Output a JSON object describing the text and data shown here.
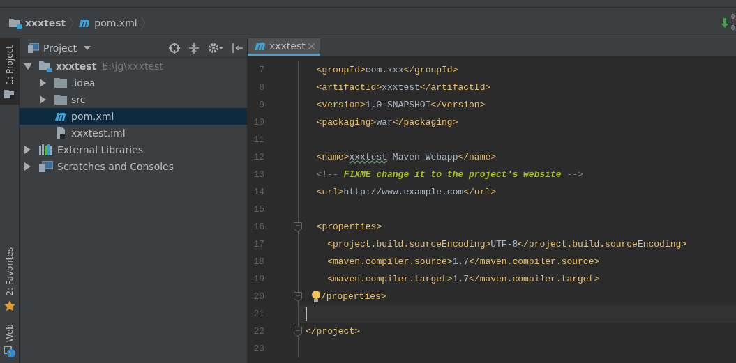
{
  "breadcrumb": [
    {
      "label": "xxxtest",
      "kind": "module"
    },
    {
      "label": "pom.xml",
      "kind": "maven"
    }
  ],
  "vcs_counter": [
    "0",
    "1",
    "0"
  ],
  "side_tabs": [
    {
      "label": "1: Project",
      "selected": true,
      "kind": "project"
    },
    {
      "label": "2: Favorites",
      "selected": false,
      "kind": "favorites"
    },
    {
      "label": "Web",
      "selected": false,
      "kind": "web"
    }
  ],
  "project_panel": {
    "title": "Project",
    "tree": [
      {
        "label": "xxxtest",
        "hint": "E:\\jg\\xxxtest",
        "kind": "module",
        "expanded": true,
        "selected": false,
        "children": [
          {
            "label": ".idea",
            "kind": "folder",
            "expanded": false,
            "selected": false
          },
          {
            "label": "src",
            "kind": "folder",
            "expanded": false,
            "selected": false
          },
          {
            "label": "pom.xml",
            "kind": "maven",
            "selected": true
          },
          {
            "label": "xxxtest.iml",
            "kind": "file",
            "selected": false
          }
        ]
      },
      {
        "label": "External Libraries",
        "kind": "libraries",
        "expanded": false,
        "selected": false
      },
      {
        "label": "Scratches and Consoles",
        "kind": "scratches",
        "expanded": false,
        "selected": false
      }
    ]
  },
  "editor": {
    "tabs": [
      {
        "label": "xxxtest",
        "selected": true
      }
    ],
    "lines": [
      {
        "number": "7",
        "tokens": [
          {
            "kind": "tag",
            "text": "  <groupId>"
          },
          {
            "kind": "text",
            "text": "com.xxx"
          },
          {
            "kind": "tag",
            "text": "</groupId>"
          }
        ]
      },
      {
        "number": "8",
        "tokens": [
          {
            "kind": "tag",
            "text": "  <artifactId>"
          },
          {
            "kind": "text",
            "text": "xxxtest"
          },
          {
            "kind": "tag",
            "text": "</artifactId>"
          }
        ]
      },
      {
        "number": "9",
        "tokens": [
          {
            "kind": "tag",
            "text": "  <version>"
          },
          {
            "kind": "text",
            "text": "1.0-SNAPSHOT"
          },
          {
            "kind": "tag",
            "text": "</version>"
          }
        ]
      },
      {
        "number": "10",
        "tokens": [
          {
            "kind": "tag",
            "text": "  <packaging>"
          },
          {
            "kind": "text",
            "text": "war"
          },
          {
            "kind": "tag",
            "text": "</packaging>"
          }
        ]
      },
      {
        "number": "11"
      },
      {
        "number": "12",
        "tokens": [
          {
            "kind": "tag",
            "text": "  <name>"
          },
          {
            "kind": "typo",
            "text": "xxxtest"
          },
          {
            "kind": "text",
            "text": " Maven Webapp"
          },
          {
            "kind": "tag",
            "text": "</name>"
          }
        ]
      },
      {
        "number": "13",
        "tokens": [
          {
            "kind": "comment",
            "text": "  <!-- "
          },
          {
            "kind": "todo",
            "text": "FIXME change it to the project's website"
          },
          {
            "kind": "comment",
            "text": " -->"
          }
        ]
      },
      {
        "number": "14",
        "tokens": [
          {
            "kind": "tag",
            "text": "  <url>"
          },
          {
            "kind": "text",
            "text": "http://www.example.com"
          },
          {
            "kind": "tag",
            "text": "</url>"
          }
        ]
      },
      {
        "number": "15"
      },
      {
        "number": "16",
        "fold": true,
        "tokens": [
          {
            "kind": "tag",
            "text": "  <properties>"
          }
        ]
      },
      {
        "number": "17",
        "tokens": [
          {
            "kind": "tag",
            "text": "    <project.build.sourceEncoding>"
          },
          {
            "kind": "text",
            "text": "UTF-8"
          },
          {
            "kind": "tag",
            "text": "</project.build.sourceEncoding>"
          }
        ]
      },
      {
        "number": "18",
        "tokens": [
          {
            "kind": "tag",
            "text": "    <maven.compiler.source>"
          },
          {
            "kind": "text",
            "text": "1.7"
          },
          {
            "kind": "tag",
            "text": "</maven.compiler.source>"
          }
        ]
      },
      {
        "number": "19",
        "tokens": [
          {
            "kind": "tag",
            "text": "    <maven.compiler.target>"
          },
          {
            "kind": "text",
            "text": "1.7"
          },
          {
            "kind": "tag",
            "text": "</maven.compiler.target>"
          }
        ]
      },
      {
        "number": "20",
        "fold": true,
        "intention": true,
        "tokens": [
          {
            "kind": "tag",
            "text": "/properties>"
          }
        ]
      },
      {
        "number": "21",
        "current": true
      },
      {
        "number": "22",
        "fold": true,
        "tokens": [
          {
            "kind": "tag",
            "text": "</project>"
          }
        ]
      },
      {
        "number": "23"
      }
    ]
  }
}
